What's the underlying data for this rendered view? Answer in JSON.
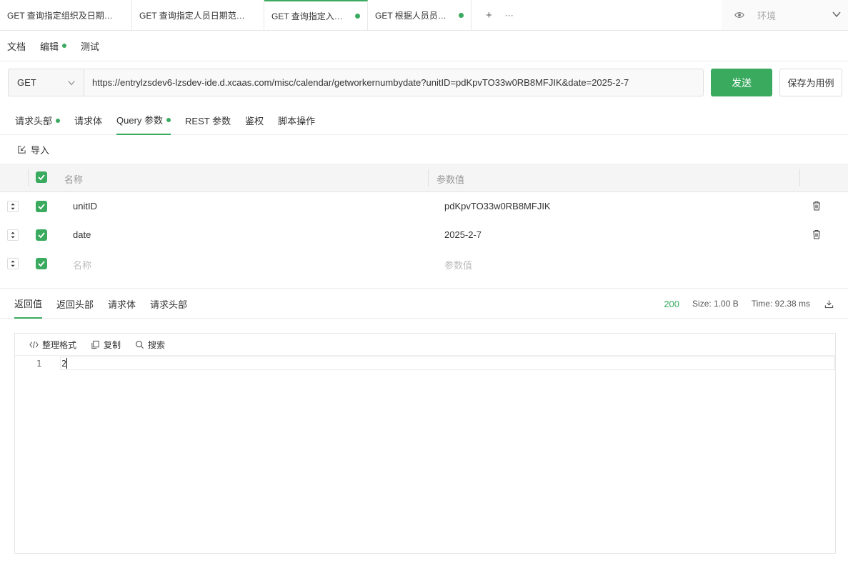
{
  "tabs": [
    {
      "label": "GET 查询指定组织及日期…",
      "dirty": false,
      "active": false
    },
    {
      "label": "GET 查询指定人员日期范…",
      "dirty": false,
      "active": false
    },
    {
      "label": "GET 查询指定入…",
      "dirty": true,
      "active": true
    },
    {
      "label": "GET 根据人员员…",
      "dirty": true,
      "active": false
    }
  ],
  "tab_actions": {
    "add": "+",
    "more": "···"
  },
  "environment": {
    "label": "环境"
  },
  "submenu": {
    "doc": "文档",
    "edit": "编辑",
    "test": "测试"
  },
  "request": {
    "method": "GET",
    "url": "https://entrylzsdev6-lzsdev-ide.d.xcaas.com/misc/calendar/getworkernumbydate?unitID=pdKpvTO33w0RB8MFJIK&date=2025-2-7",
    "send_label": "发送",
    "save_label": "保存为用例"
  },
  "request_tabs": {
    "headers": "请求头部",
    "body": "请求体",
    "query": "Query 参数",
    "rest": "REST 参数",
    "auth": "鉴权",
    "script": "脚本操作"
  },
  "import_label": "导入",
  "params_table": {
    "col_name": "名称",
    "col_value": "参数值",
    "rows": [
      {
        "name": "unitID",
        "value": "pdKpvTO33w0RB8MFJIK"
      },
      {
        "name": "date",
        "value": "2025-2-7"
      }
    ],
    "new_row": {
      "name_placeholder": "名称",
      "value_placeholder": "参数值"
    }
  },
  "response_tabs": {
    "body": "返回值",
    "headers": "返回头部",
    "req_body": "请求体",
    "req_headers": "请求头部"
  },
  "response_meta": {
    "status": "200",
    "size": "Size: 1.00 B",
    "time": "Time: 92.38 ms"
  },
  "editor": {
    "format_label": "整理格式",
    "copy_label": "复制",
    "search_label": "搜索",
    "line_number": "1",
    "line_text": "2"
  },
  "colors": {
    "accent": "#3aaa5f"
  }
}
